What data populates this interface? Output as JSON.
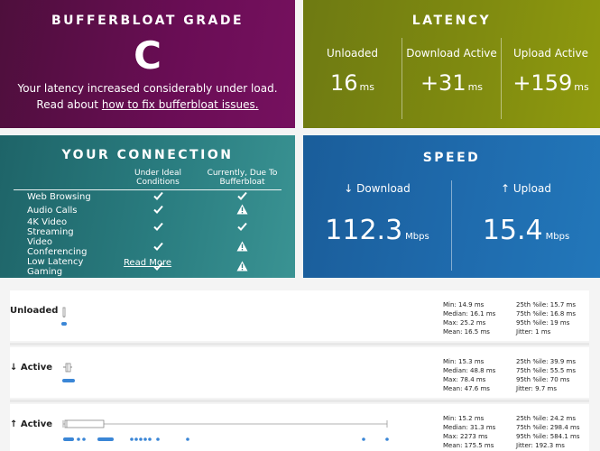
{
  "grade": {
    "title": "BUFFERBLOAT GRADE",
    "letter": "C",
    "message": "Your latency increased considerably under load.",
    "read_prefix": "Read about ",
    "link": "how to fix bufferbloat issues."
  },
  "latency": {
    "title": "LATENCY",
    "unit": "ms",
    "cols": [
      {
        "label": "Unloaded",
        "value": "16"
      },
      {
        "label": "Download Active",
        "value": "+31"
      },
      {
        "label": "Upload Active",
        "value": "+159"
      }
    ]
  },
  "connection": {
    "title": "YOUR CONNECTION",
    "col1": "Under Ideal Conditions",
    "col2": "Currently, Due To Bufferbloat",
    "rows": [
      {
        "name": "Web Browsing",
        "ideal": "check",
        "current": "check"
      },
      {
        "name": "Audio Calls",
        "ideal": "check",
        "current": "warn"
      },
      {
        "name": "4K Video Streaming",
        "ideal": "check",
        "current": "check"
      },
      {
        "name": "Video Conferencing",
        "ideal": "check",
        "current": "warn"
      },
      {
        "name": "Low Latency Gaming",
        "ideal": "check",
        "current": "warn"
      }
    ],
    "read_more": "Read More"
  },
  "speed": {
    "title": "SPEED",
    "unit": "Mbps",
    "download_label": "↓ Download",
    "download_value": "112.3",
    "upload_label": "↑ Upload",
    "upload_value": "15.4"
  },
  "distribution": {
    "rows": [
      {
        "label": "Unloaded",
        "left": [
          "Min: 14.9 ms",
          "Median: 16.1 ms",
          "Max: 25.2 ms",
          "Mean: 16.5 ms"
        ],
        "right": [
          "25th %ile: 15.7 ms",
          "75th %ile: 16.8 ms",
          "95th %ile: 19 ms",
          "Jitter: 1 ms"
        ]
      },
      {
        "label": "↓ Active",
        "left": [
          "Min: 15.3 ms",
          "Median: 48.8 ms",
          "Max: 78.4 ms",
          "Mean: 47.6 ms"
        ],
        "right": [
          "25th %ile: 39.9 ms",
          "75th %ile: 55.5 ms",
          "95th %ile: 70 ms",
          "Jitter: 9.7 ms"
        ]
      },
      {
        "label": "↑ Active",
        "left": [
          "Min: 15.2 ms",
          "Median: 31.3 ms",
          "Max: 2273 ms",
          "Mean: 175.5 ms"
        ],
        "right": [
          "25th %ile: 24.2 ms",
          "75th %ile: 298.4 ms",
          "95th %ile: 584.1 ms",
          "Jitter: 192.3 ms"
        ]
      }
    ]
  },
  "colors": {
    "grade_bg": "#6a0d55",
    "latency_bg": "#7f8a10",
    "connection_bg": "#2a7d80",
    "speed_bg": "#1f6bad",
    "dot_blue": "#3a86d6"
  }
}
